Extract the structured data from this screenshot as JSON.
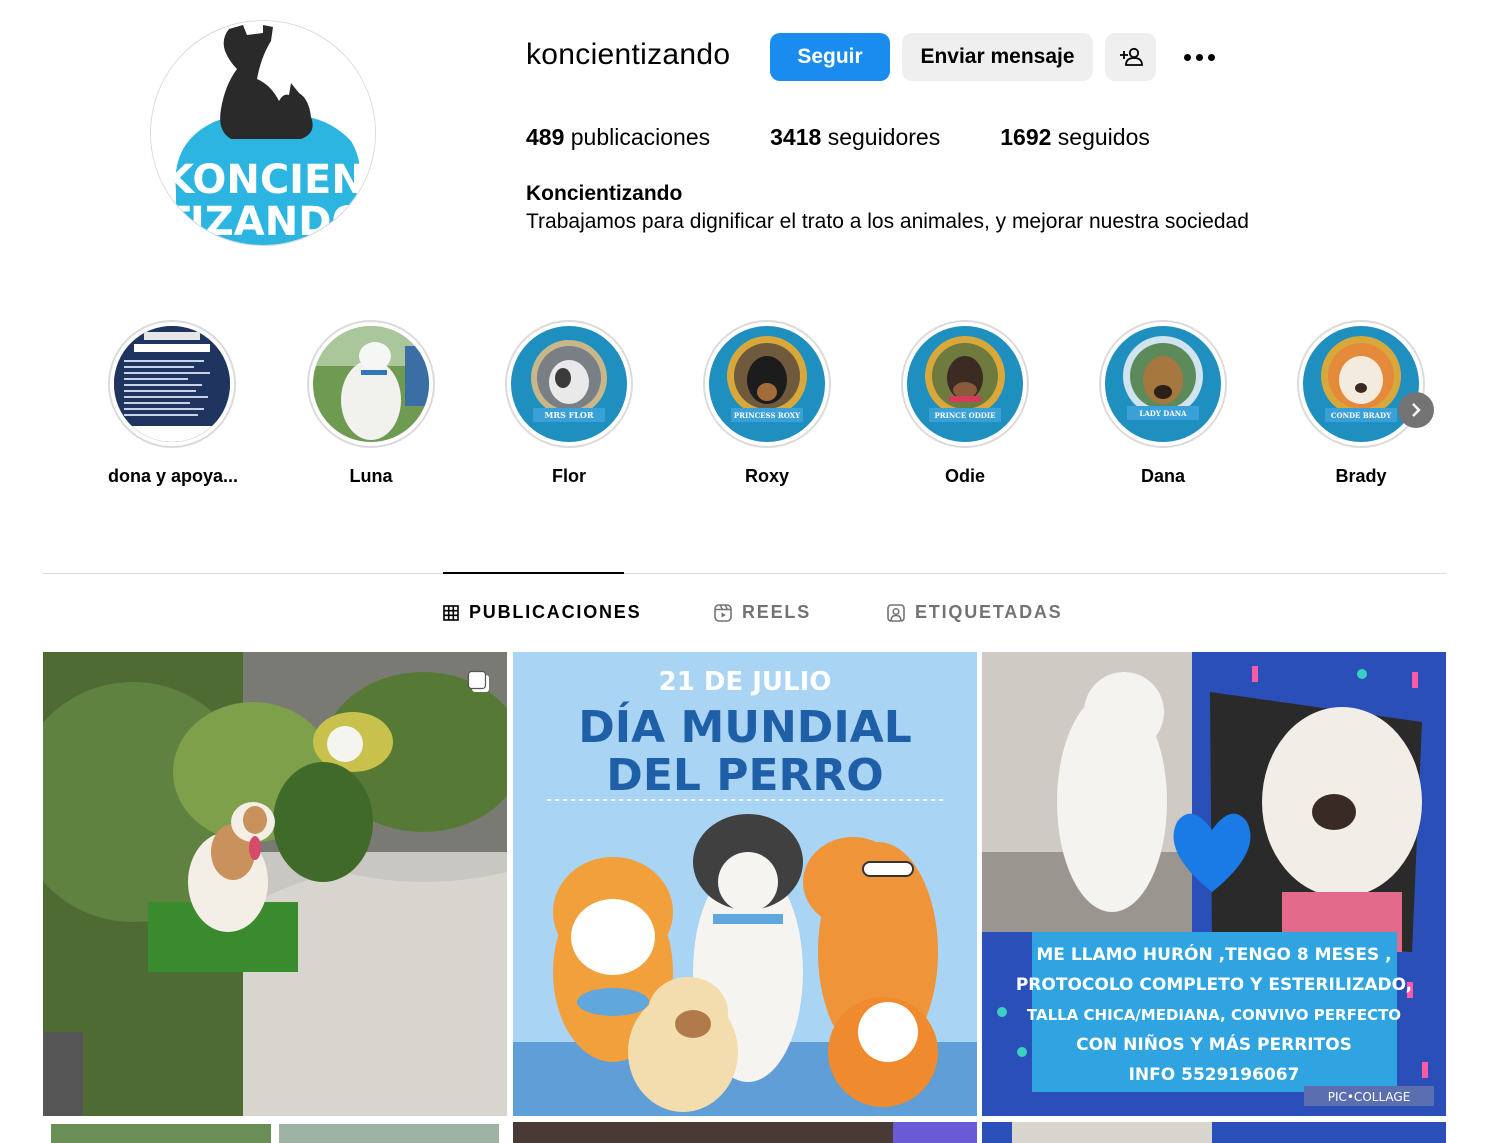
{
  "profile": {
    "username": "koncientizando",
    "follow_label": "Seguir",
    "message_label": "Enviar mensaje",
    "avatar_text_1": "KONCIEN",
    "avatar_text_2": "TIZANDO",
    "stats": {
      "posts_count": "489",
      "posts_label": " publicaciones",
      "followers_count": "3418",
      "followers_label": " seguidores",
      "following_count": "1692",
      "following_label": " seguidos"
    },
    "full_name": "Koncientizando",
    "bio": "Trabajamos para dignificar el trato a los animales, y mejorar nuestra sociedad"
  },
  "highlights": [
    {
      "label": "dona y apoya...",
      "plaque": ""
    },
    {
      "label": "Luna",
      "plaque": ""
    },
    {
      "label": "Flor",
      "plaque": "MRS FLOR"
    },
    {
      "label": "Roxy",
      "plaque": "PRINCESS ROXY"
    },
    {
      "label": "Odie",
      "plaque": "PRINCE ODDIE"
    },
    {
      "label": "Dana",
      "plaque": "LADY DANA"
    },
    {
      "label": "Brady",
      "plaque": "CONDE BRADY"
    }
  ],
  "tabs": [
    {
      "label": "PUBLICACIONES",
      "icon": "grid-icon"
    },
    {
      "label": "REELS",
      "icon": "reels-icon"
    },
    {
      "label": "ETIQUETADAS",
      "icon": "tagged-icon"
    }
  ],
  "posts": {
    "post2": {
      "date_line": "21 DE JULIO",
      "title_1": "DÍA MUNDIAL",
      "title_2": "DEL PERRO"
    },
    "post3": {
      "lines": [
        "ME LLAMO HURÓN ,TENGO 8 MESES ,",
        "PROTOCOLO COMPLETO Y ESTERILIZADO,",
        "TALLA CHICA/MEDIANA, CONVIVO PERFECTO",
        "CON NIÑOS Y MÁS PERRITOS",
        "INFO 5529196067"
      ],
      "watermark": "PIC•COLLAGE"
    }
  },
  "colors": {
    "primary_blue": "#1a8cf0",
    "secondary_gray": "#efefef",
    "border": "#dbdbdb",
    "muted_text": "#737373",
    "brand_cyan": "#2bb5e0"
  }
}
